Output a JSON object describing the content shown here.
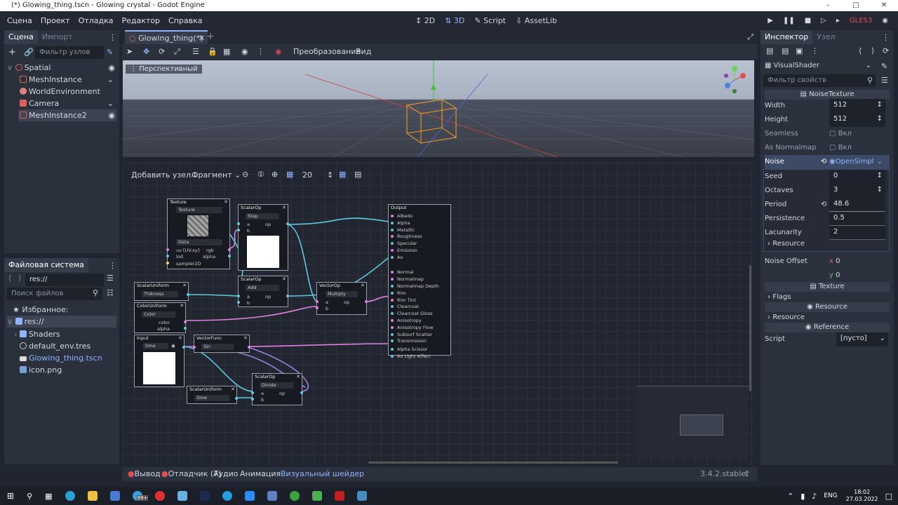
{
  "window": {
    "title": "(*) Glowing_thing.tscn - Glowing crystal - Godot Engine"
  },
  "menu": [
    "Сцена",
    "Проект",
    "Отладка",
    "Редактор",
    "Справка"
  ],
  "modes": {
    "m2d": "2D",
    "m3d": "3D",
    "script": "Script",
    "assetlib": "AssetLib"
  },
  "renderer": "GLES3",
  "scene_dock": {
    "tabs": [
      "Сцена",
      "Импорт"
    ],
    "filter_placeholder": "Фильтр узлов",
    "tree": [
      {
        "label": "Spatial",
        "icon": "spatial-icon"
      },
      {
        "label": "MeshInstance",
        "icon": "mesh-instance-icon"
      },
      {
        "label": "WorldEnvironment",
        "icon": "world-environment-icon"
      },
      {
        "label": "Camera",
        "icon": "camera-icon"
      },
      {
        "label": "MeshInstance2",
        "icon": "mesh-instance-icon"
      }
    ]
  },
  "filesystem_dock": {
    "title": "Файловая система",
    "path": "res://",
    "search_placeholder": "Поиск файлов",
    "items": [
      {
        "label": "Избранное:",
        "icon": "star-icon"
      },
      {
        "label": "res://",
        "icon": "folder-icon"
      },
      {
        "label": "Shaders",
        "icon": "folder-icon"
      },
      {
        "label": "default_env.tres",
        "icon": "environment-icon"
      },
      {
        "label": "Glowing_thing.tscn",
        "icon": "scene-icon"
      },
      {
        "label": "icon.png",
        "icon": "image-icon"
      }
    ]
  },
  "editor": {
    "scene_tab": "Glowing_thing(*)",
    "toolbar": {
      "transform": "Преобразование",
      "view": "Вид"
    },
    "viewport_label": "Перспективный"
  },
  "shader_toolbar": {
    "add_node": "Добавить узел...",
    "mode": "Фрагмент",
    "zoom": "20"
  },
  "nodes": {
    "texture": {
      "title": "Texture",
      "source": "Texture",
      "type": "Data",
      "uv": "uv",
      "uv_hint": "[UV.xy]",
      "lod": "lod",
      "sampler": "sampler2D",
      "rgb": "rgb",
      "alpha": "alpha"
    },
    "scalar_step": {
      "title": "ScalarOp",
      "op": "Step",
      "a": "a",
      "b": "b",
      "out": "op"
    },
    "scalar_add": {
      "title": "ScalarOp",
      "op": "Add",
      "a": "a",
      "b": "b",
      "out": "op"
    },
    "thikness": {
      "title": "ScalarUniform",
      "name": "Thikness"
    },
    "color_uniform": {
      "title": "ColorUniform",
      "name": "Color",
      "color": "color",
      "alpha": "alpha"
    },
    "input": {
      "title": "Input",
      "value": "time"
    },
    "vector_op": {
      "title": "VectorOp",
      "op": "Multiply",
      "a": "a",
      "b": "b",
      "out": "op"
    },
    "vector_func": {
      "title": "VectorFunc",
      "func": "Sin"
    },
    "scalar_divide": {
      "title": "ScalarOp",
      "op": "Divide",
      "a": "a",
      "b": "b",
      "out": "op"
    },
    "slow_uniform": {
      "title": "ScalarUniform",
      "name": "Slow"
    },
    "output": {
      "title": "Output",
      "ports": [
        "Albedo",
        "Alpha",
        "Metallic",
        "Roughness",
        "Specular",
        "Emission",
        "Ao",
        "",
        "Normal",
        "Normalmap",
        "Normalmap Depth",
        "Rim",
        "Rim Tint",
        "Clearcoat",
        "Clearcoat Gloss",
        "Anisotropy",
        "Anisotropy Flow",
        "Subsurf Scatter",
        "Transmission",
        "Alpha Scissor",
        "Ao Light Affect"
      ]
    }
  },
  "bottom_bar": {
    "output": "Вывод",
    "debugger": "Отладчик (7)",
    "audio": "Аудио",
    "animation": "Анимация",
    "visual_shader": "Визуальный шейдер",
    "version": "3.4.2.stable"
  },
  "inspector": {
    "tabs": [
      "Инспектор",
      "Узел"
    ],
    "resource": "VisualShader",
    "filter_placeholder": "Фильтр свойств",
    "section_noise_texture": "NoiseTexture",
    "width_label": "Width",
    "width": "512",
    "height_label": "Height",
    "height": "512",
    "seamless_label": "Seamless",
    "seamless": "Вкл",
    "normalmap_label": "As Normalmap",
    "normalmap": "Вкл",
    "noise_label": "Noise",
    "noise": "OpenSimpl",
    "seed_label": "Seed",
    "seed": "0",
    "octaves_label": "Octaves",
    "octaves": "3",
    "period_label": "Period",
    "period": "48.6",
    "persistence_label": "Persistence",
    "persistence": "0.5",
    "lacunarity_label": "Lacunarity",
    "lacunarity": "2",
    "resource_label": "Resource",
    "noise_offset_label": "Noise Offset",
    "offset_x_label": "x",
    "offset_x": "0",
    "offset_y_label": "y",
    "offset_y": "0",
    "section_texture": "Texture",
    "flags_label": "Flags",
    "section_resource": "Resource",
    "resource2_label": "Resource",
    "section_reference": "Reference",
    "script_label": "Script",
    "script": "[пусто]"
  },
  "taskbar": {
    "lang": "ENG",
    "time": "18:02",
    "date": "27.03.2022",
    "badge": "99+"
  },
  "colors": {
    "accent": "#8fb4ff",
    "panel": "#2b303d",
    "background": "#202531"
  }
}
